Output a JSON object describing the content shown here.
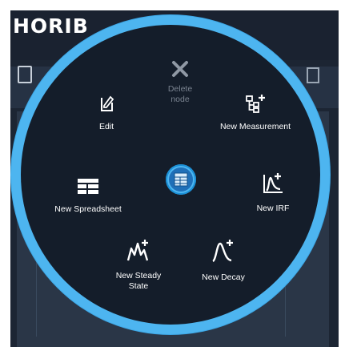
{
  "app": {
    "brand_text": "HORIB"
  },
  "radial_menu": {
    "items": [
      {
        "id": "delete",
        "label": "Delete node",
        "icon": "close-icon",
        "enabled": false
      },
      {
        "id": "edit",
        "label": "Edit",
        "icon": "edit-icon",
        "enabled": true
      },
      {
        "id": "new_measurement",
        "label": "New Measurement",
        "icon": "new-measurement-icon",
        "enabled": true
      },
      {
        "id": "new_spreadsheet",
        "label": "New Spreadsheet",
        "icon": "spreadsheet-icon",
        "enabled": true
      },
      {
        "id": "new_irf",
        "label": "New IRF",
        "icon": "new-irf-icon",
        "enabled": true
      },
      {
        "id": "new_steady_state",
        "label": "New Steady State",
        "icon": "new-steady-state-icon",
        "enabled": true
      },
      {
        "id": "new_decay",
        "label": "New Decay",
        "icon": "new-decay-icon",
        "enabled": true
      }
    ],
    "center_icon": "spreadsheet-node-icon"
  },
  "colors": {
    "accent": "#4db5f0",
    "menu_background": "#141d2a",
    "disabled_text": "#7a8390"
  }
}
